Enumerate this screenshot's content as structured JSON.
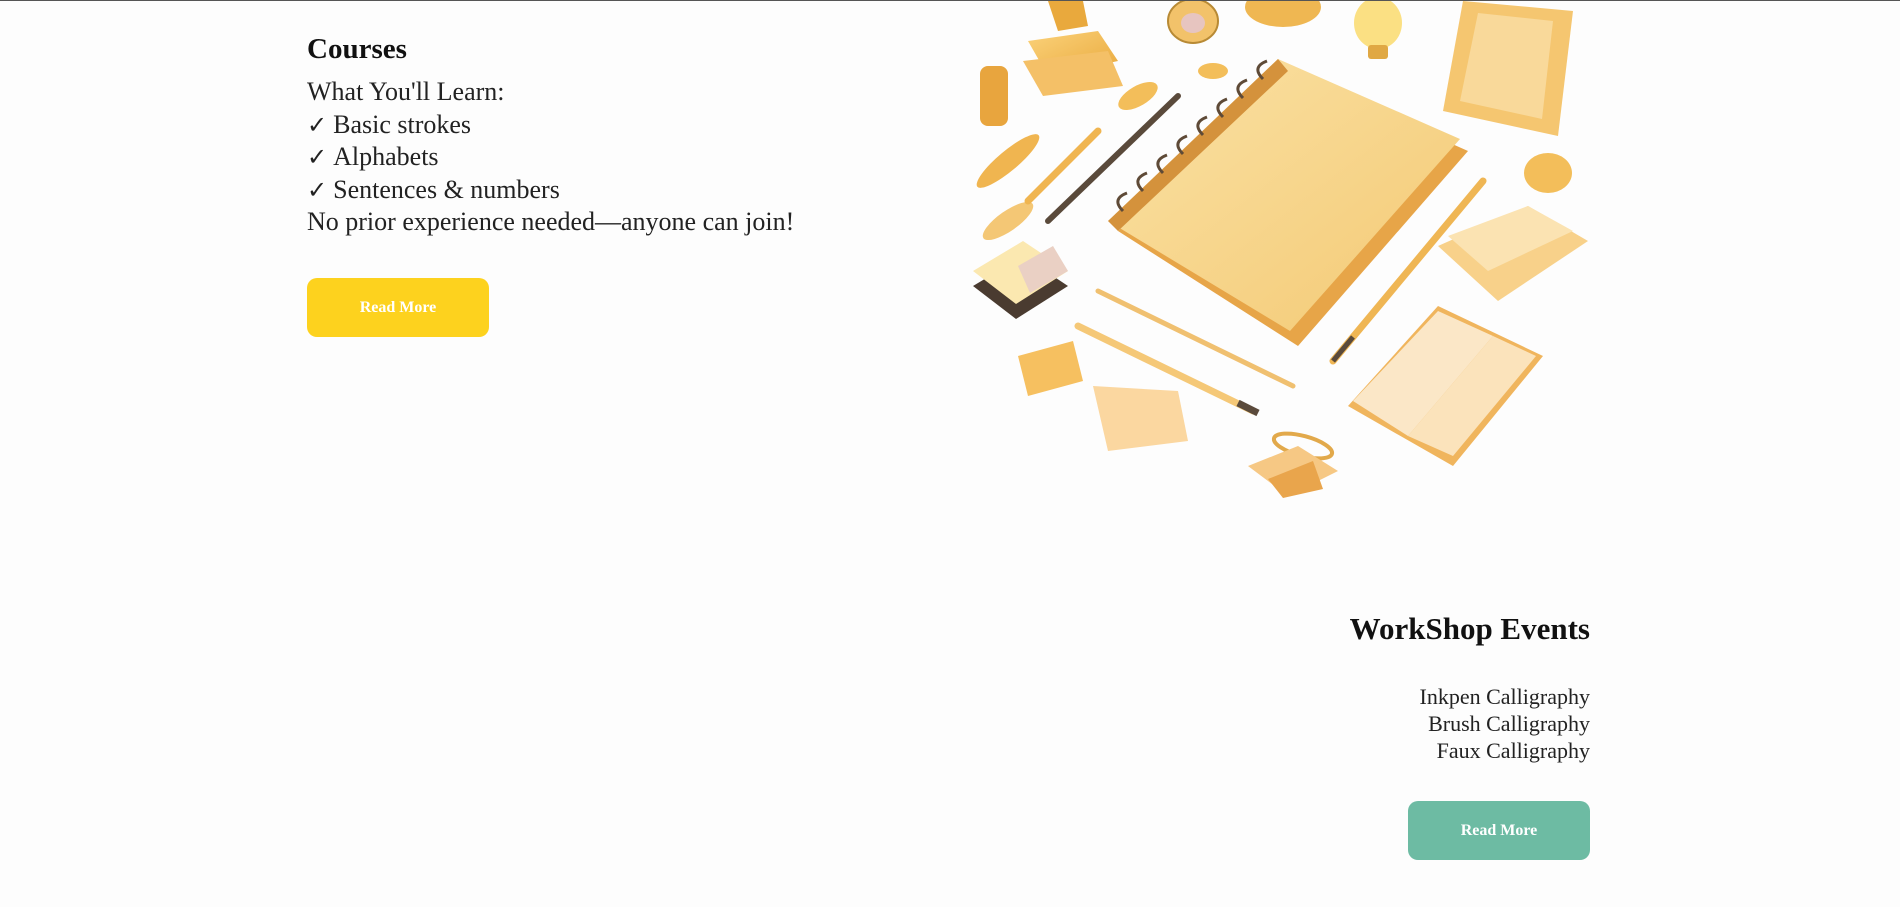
{
  "courses": {
    "title": "Courses",
    "intro": "What You'll Learn:",
    "check_glyph": "✓",
    "items": [
      "Basic strokes",
      "Alphabets",
      "Sentences & numbers"
    ],
    "note": "No prior experience needed—anyone can join!",
    "button_label": "Read More"
  },
  "workshop": {
    "title": "WorkShop Events",
    "items": [
      "Inkpen Calligraphy",
      "Brush Calligraphy",
      "Faux Calligraphy"
    ],
    "button_label": "Read More"
  },
  "colors": {
    "yellow_button": "#fdd21e",
    "green_button": "#6dbba3",
    "illustration_main": "#f7c96a"
  },
  "illustration": {
    "icon": "stationery-flatlay-illustration"
  }
}
